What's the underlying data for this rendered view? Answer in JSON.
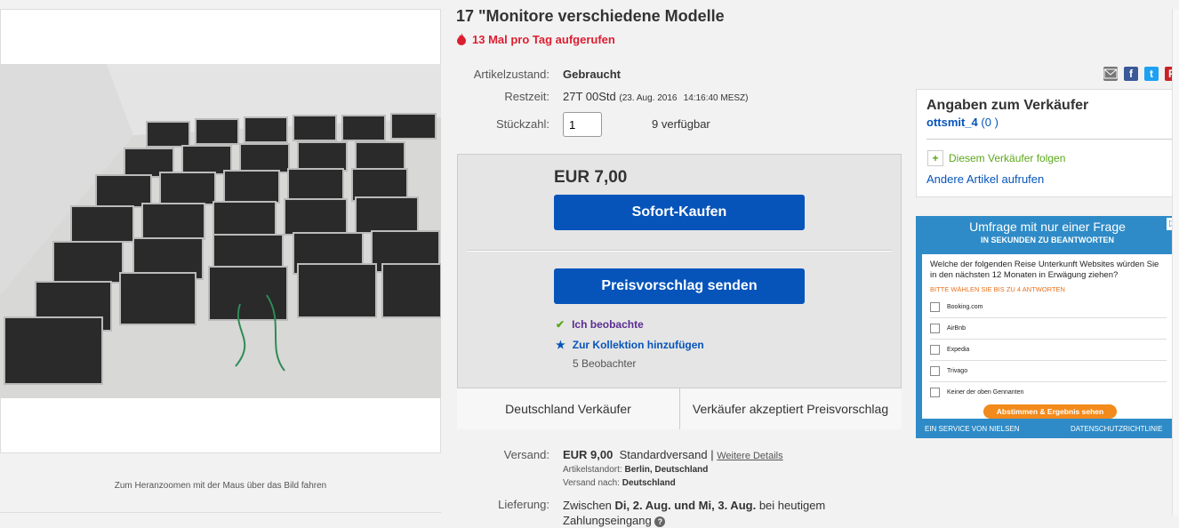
{
  "listing": {
    "title": "17 \"Monitore verschiedene Modelle",
    "views_text": "13 Mal pro Tag aufgerufen",
    "zoom_hint": "Zum Heranzoomen mit der Maus über das Bild fahren"
  },
  "details": {
    "condition_label": "Artikelzustand:",
    "condition_value": "Gebraucht",
    "time_label": "Restzeit:",
    "time_value": "27T 00Std",
    "time_end": "(23. Aug. 2016",
    "time_clock": "14:16:40 MESZ)",
    "qty_label": "Stückzahl:",
    "qty_value": "1",
    "available": "9 verfügbar"
  },
  "buybox": {
    "price": "EUR 7,00",
    "buy_now": "Sofort-Kaufen",
    "make_offer": "Preisvorschlag senden",
    "watching": "Ich beobachte",
    "add_collection": "Zur Kollektion hinzufügen",
    "watchers": "5 Beobachter",
    "seller_country": "Deutschland Verkäufer",
    "accepts_offer": "Verkäufer akzeptiert Preisvorschlag"
  },
  "shipping": {
    "label": "Versand:",
    "price": "EUR 9,00",
    "method": "Standardversand |",
    "details_link": "Weitere Details",
    "location_label": "Artikelstandort:",
    "location_value": "Berlin, Deutschland",
    "ships_to_label": "Versand nach:",
    "ships_to_value": "Deutschland",
    "delivery_label": "Lieferung:",
    "delivery_prefix": "Zwischen",
    "delivery_dates": "Di, 2. Aug. und Mi, 3. Aug.",
    "delivery_suffix": "bei heutigem",
    "delivery_line2": "Zahlungseingang"
  },
  "seller": {
    "heading": "Angaben zum Verkäufer",
    "name": "ottsmit_4",
    "feedback": "(0 )",
    "follow": "Diesem Verkäufer folgen",
    "other_items": "Andere Artikel aufrufen"
  },
  "survey": {
    "title": "Umfrage mit nur einer Frage",
    "subtitle": "IN SEKUNDEN ZU BEANTWORTEN",
    "question": "Welche der folgenden Reise Unterkunft Websites würden Sie in den nächsten 12 Monaten in Erwägung ziehen?",
    "instruction": "BITTE WÄHLEN SIE BIS ZU 4 ANTWORTEN",
    "options": [
      "Booking.com",
      "AirBnb",
      "Expedia",
      "Trivago",
      "Keiner der oben Gennanten"
    ],
    "submit": "Abstimmen & Ergebnis sehen",
    "footer_left": "EIN SERVICE VON NIELSEN",
    "footer_right": "DATENSCHUTZRICHTLINIE"
  },
  "social": {
    "facebook": "f",
    "twitter": "t",
    "pinterest": "P"
  },
  "colors": {
    "button_blue": "#0654ba",
    "views_red": "#dd1e31",
    "link_blue": "#0654ba",
    "ad_blue": "#2e8bc7",
    "ad_orange": "#f28a1c"
  }
}
